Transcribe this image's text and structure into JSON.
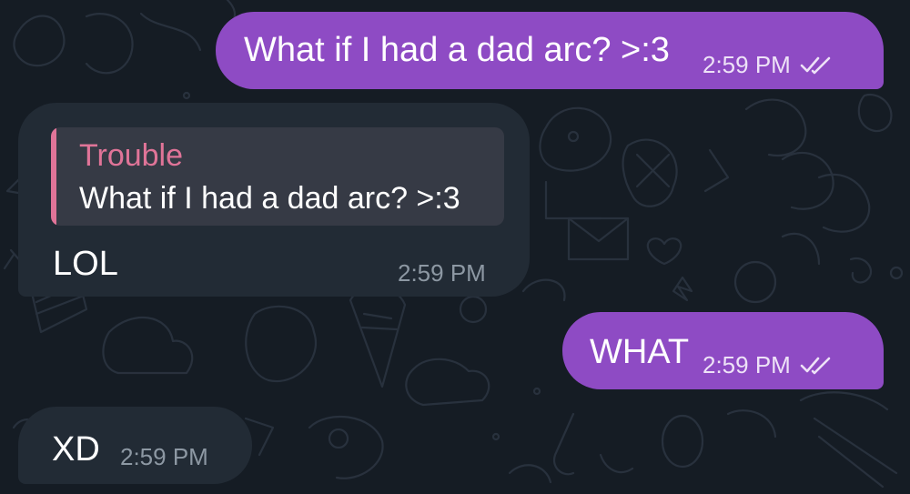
{
  "theme": {
    "background": "#151c24",
    "outgoing_bubble": "#8e4bc4",
    "incoming_bubble": "#222b35",
    "reply_box": "#363a45",
    "reply_accent": "#e07498",
    "incoming_time_color": "#8d98a3",
    "outgoing_time_color": "#eee2f7"
  },
  "messages": [
    {
      "direction": "outgoing",
      "text": "What if I had a dad arc? >:3",
      "time": "2:59 PM",
      "status_icon": "double-check-read-icon"
    },
    {
      "direction": "incoming",
      "reply": {
        "name": "Trouble",
        "text": "What if I had a dad arc? >:3"
      },
      "text": "LOL",
      "time": "2:59 PM"
    },
    {
      "direction": "outgoing",
      "text": "WHAT",
      "time": "2:59 PM",
      "status_icon": "double-check-read-icon"
    },
    {
      "direction": "incoming",
      "text": "XD",
      "time": "2:59 PM"
    }
  ]
}
